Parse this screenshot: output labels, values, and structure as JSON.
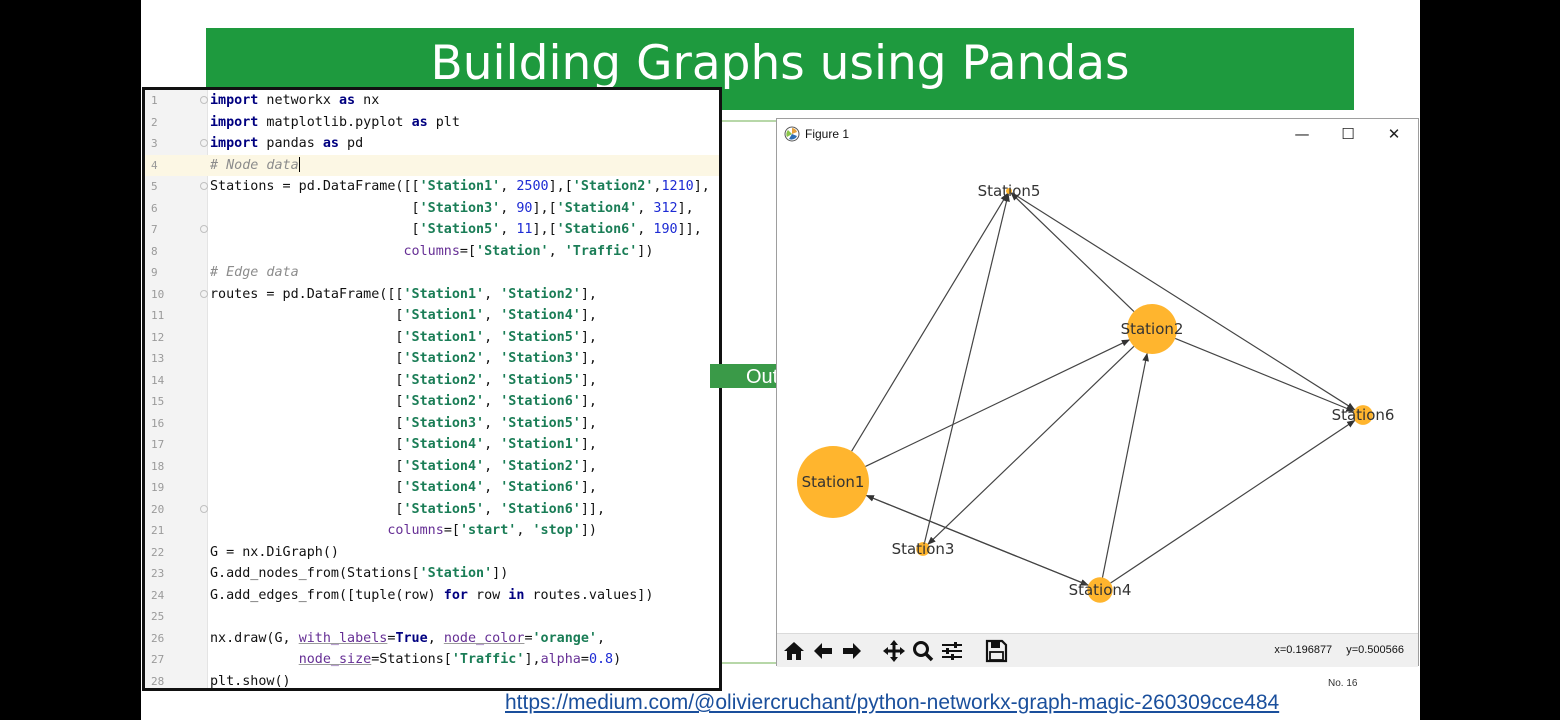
{
  "slide": {
    "title": "Building Graphs using Pandas",
    "arrow_label": "Output",
    "slide_number": "No. 16",
    "source_url": "https://medium.com/@oliviercruchant/python-networkx-graph-magic-260309cce484"
  },
  "code": {
    "lines": [
      "1",
      "2",
      "3",
      "4",
      "5",
      "6",
      "7",
      "8",
      "9",
      "10",
      "11",
      "12",
      "13",
      "14",
      "15",
      "16",
      "17",
      "18",
      "19",
      "20",
      "21",
      "22",
      "23",
      "24",
      "25",
      "26",
      "27",
      "28"
    ]
  },
  "figure": {
    "window_title": "Figure 1",
    "window_controls": {
      "minimize": "—",
      "maximize": "☐",
      "close": "✕"
    },
    "nodes": [
      {
        "label": "Station5",
        "traffic": 11
      },
      {
        "label": "Station2",
        "traffic": 1210
      },
      {
        "label": "Station6",
        "traffic": 190
      },
      {
        "label": "Station1",
        "traffic": 2500
      },
      {
        "label": "Station3",
        "traffic": 90
      },
      {
        "label": "Station4",
        "traffic": 312
      }
    ],
    "edges": [
      [
        "Station1",
        "Station2"
      ],
      [
        "Station1",
        "Station4"
      ],
      [
        "Station1",
        "Station5"
      ],
      [
        "Station2",
        "Station3"
      ],
      [
        "Station2",
        "Station5"
      ],
      [
        "Station2",
        "Station6"
      ],
      [
        "Station3",
        "Station5"
      ],
      [
        "Station4",
        "Station1"
      ],
      [
        "Station4",
        "Station2"
      ],
      [
        "Station4",
        "Station6"
      ],
      [
        "Station5",
        "Station6"
      ]
    ],
    "node_color": "#ffa500",
    "toolbar": [
      "home-icon",
      "back-icon",
      "forward-icon",
      "pan-icon",
      "zoom-icon",
      "configure-icon",
      "save-icon"
    ],
    "coords": {
      "x": "x=0.196877",
      "y": "y=0.500566"
    }
  },
  "colors": {
    "title_bar": "#1e9a3e",
    "arrow": "#3a9a48"
  }
}
